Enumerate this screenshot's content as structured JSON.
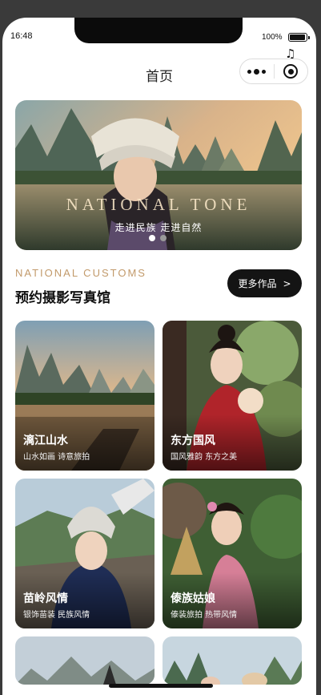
{
  "status_bar": {
    "time": "16:48",
    "battery": "100%",
    "music_icon": "music-note-icon"
  },
  "nav": {
    "title": "首页",
    "menu_icon": "more-dots-icon",
    "close_icon": "record-target-icon"
  },
  "banner": {
    "title": "NATIONAL TONE",
    "subtitle": "走进民族 走进自然",
    "dots": {
      "count": 2,
      "active_index": 0,
      "active_color": "#ffffff",
      "inactive_color": "#9a9a9a"
    }
  },
  "section": {
    "en_title": "NATIONAL CUSTOMS",
    "cn_title": "预约摄影写真馆",
    "more_button": {
      "label": "更多作品",
      "arrow": ">"
    }
  },
  "cards": [
    {
      "title": "漓江山水",
      "subtitle": "山水如画 诗意旅拍"
    },
    {
      "title": "东方国风",
      "subtitle": "国风雅韵 东方之美"
    },
    {
      "title": "苗岭风情",
      "subtitle": "银饰苗装 民族风情"
    },
    {
      "title": "傣族姑娘",
      "subtitle": "傣装旅拍 热带风情"
    }
  ],
  "colors": {
    "accent_gold": "#c29a6b",
    "button_dark": "#141414",
    "frame_dark": "#3a3a3a"
  }
}
